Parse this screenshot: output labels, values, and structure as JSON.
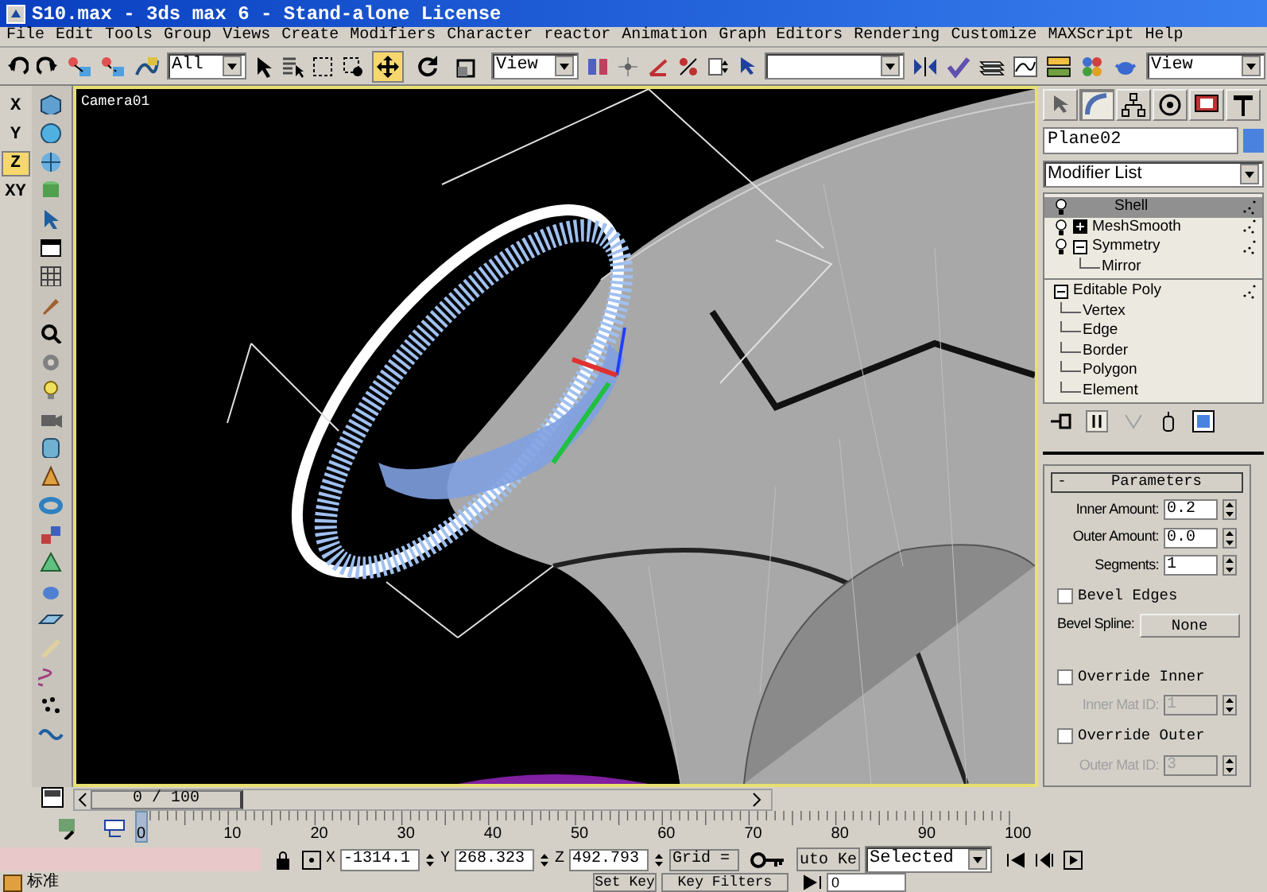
{
  "window": {
    "title": "S10.max - 3ds max 6 - Stand-alone License"
  },
  "menu": [
    "File",
    "Edit",
    "Tools",
    "Group",
    "Views",
    "Create",
    "Modifiers",
    "Character",
    "reactor",
    "Animation",
    "Graph Editors",
    "Rendering",
    "Customize",
    "MAXScript",
    "Help"
  ],
  "toolbar": {
    "selection_filter": "All",
    "transform_tools": [
      {
        "selected": true
      },
      {
        "selected": false
      },
      {
        "selected": false
      }
    ],
    "reference_coordinate": "View",
    "view_dropdown": "View"
  },
  "axis_constraints": [
    {
      "label": "X",
      "selected": false
    },
    {
      "label": "Y",
      "selected": false
    },
    {
      "label": "Z",
      "selected": true
    },
    {
      "label": "XY",
      "selected": false
    }
  ],
  "viewport": {
    "label": "Camera01"
  },
  "command_panel": {
    "tabs": [
      {
        "selected": false
      },
      {
        "selected": true
      },
      {
        "selected": false
      },
      {
        "selected": false
      },
      {
        "selected": false
      },
      {
        "selected": false
      }
    ],
    "object_name": "Plane02",
    "modifier_list": "Modifier List",
    "stack": [
      {
        "kind": "modifier",
        "label": "Shell",
        "selected": true
      },
      {
        "kind": "modifier",
        "label": "MeshSmooth",
        "selected": false,
        "expanded": false
      },
      {
        "kind": "modifier",
        "label": "Symmetry",
        "selected": false,
        "expanded": true,
        "children": [
          {
            "label": "Mirror"
          }
        ]
      },
      {
        "kind": "base",
        "label": "Editable Poly",
        "selected": false,
        "expanded": true,
        "children": [
          {
            "label": "Vertex"
          },
          {
            "label": "Edge"
          },
          {
            "label": "Border"
          },
          {
            "label": "Polygon"
          },
          {
            "label": "Element"
          }
        ]
      }
    ],
    "rollout": {
      "toggle": "-",
      "title": "Parameters",
      "controls": [
        {
          "kind": "spinner",
          "label": "Inner Amount:",
          "value": "0.2",
          "disabled": false
        },
        {
          "kind": "spinner",
          "label": "Outer Amount:",
          "value": "0.0",
          "disabled": false
        },
        {
          "kind": "spinner",
          "label": "Segments:",
          "value": "1",
          "disabled": false
        },
        {
          "kind": "checkbox",
          "label": "Bevel Edges",
          "checked": false
        },
        {
          "kind": "button",
          "label": "Bevel Spline:",
          "value": "None"
        },
        {
          "kind": "checkbox",
          "label": "Override Inner",
          "checked": false
        },
        {
          "kind": "spinner",
          "label": "Inner Mat ID:",
          "value": "1",
          "disabled": true
        },
        {
          "kind": "checkbox",
          "label": "Override Outer",
          "checked": false
        },
        {
          "kind": "spinner",
          "label": "Outer Mat ID:",
          "value": "3",
          "disabled": true
        }
      ]
    }
  },
  "timeline": {
    "frame": "0 / 100",
    "level": 0,
    "ticks": [
      "0",
      "10",
      "20",
      "30",
      "40",
      "50",
      "60",
      "70",
      "80",
      "90",
      "100"
    ]
  },
  "status": {
    "prompt": "标准",
    "coordinates": [
      {
        "axis": "X",
        "value": "-1314.1"
      },
      {
        "axis": "Y",
        "value": "268.323"
      },
      {
        "axis": "Z",
        "value": "492.793"
      }
    ],
    "grid": "Grid =",
    "auto_key": "uto Ke",
    "key_mode": "Selected",
    "set_key": "Set Key",
    "key_filters": "Key Filters",
    "current_frame": "0"
  }
}
